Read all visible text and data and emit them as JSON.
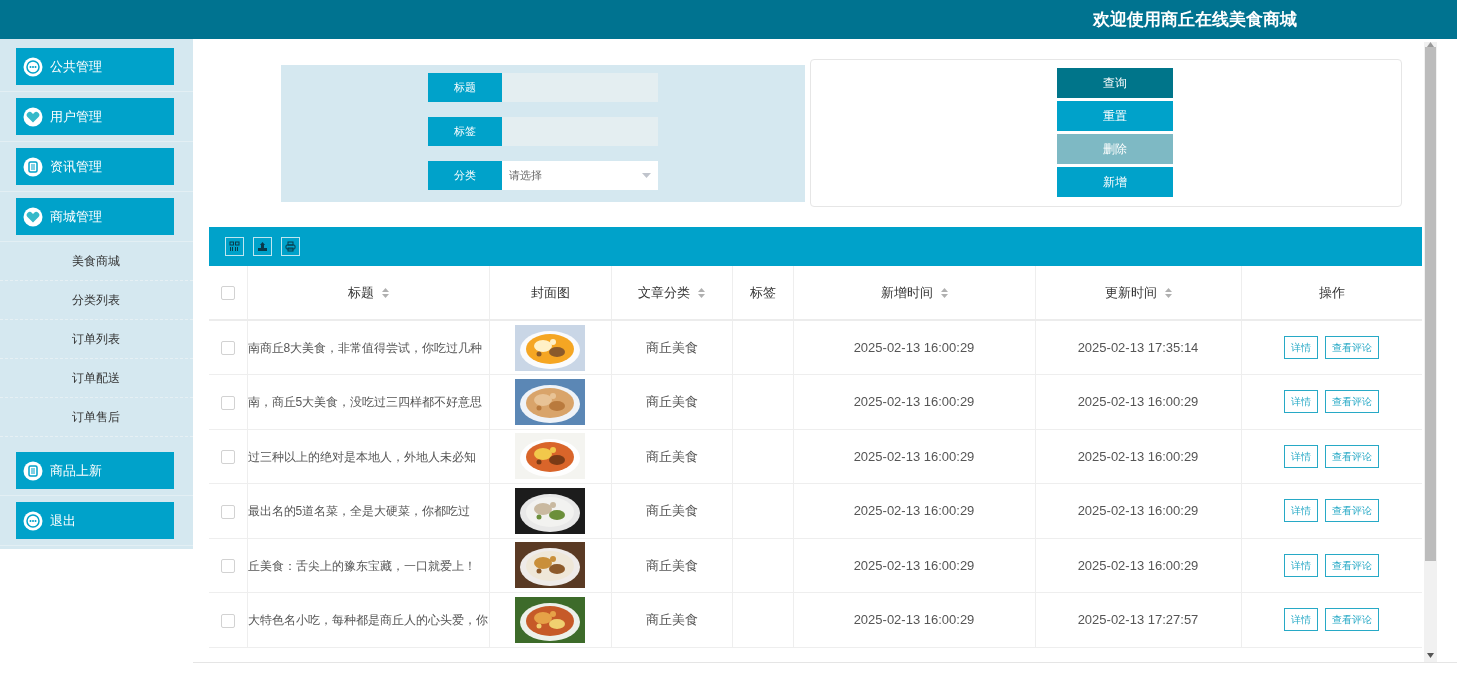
{
  "header": {
    "title": "欢迎使用商丘在线美食商城"
  },
  "sidebar": {
    "items": [
      {
        "label": "公共管理"
      },
      {
        "label": "用户管理"
      },
      {
        "label": "资讯管理"
      },
      {
        "label": "商城管理",
        "children": [
          {
            "label": "美食商城"
          },
          {
            "label": "分类列表"
          },
          {
            "label": "订单列表"
          },
          {
            "label": "订单配送"
          },
          {
            "label": "订单售后"
          }
        ]
      },
      {
        "label": "商品上新"
      },
      {
        "label": "退出"
      }
    ]
  },
  "search": {
    "fields": [
      {
        "label": "标题",
        "kind": "text"
      },
      {
        "label": "标签",
        "kind": "text"
      },
      {
        "label": "分类",
        "kind": "select",
        "placeholder": "请选择"
      }
    ]
  },
  "actions": [
    {
      "label": "查询",
      "kind": "primary",
      "disabled": false
    },
    {
      "label": "重置",
      "kind": "normal",
      "disabled": false
    },
    {
      "label": "删除",
      "kind": "primary",
      "disabled": true
    },
    {
      "label": "新增",
      "kind": "normal",
      "disabled": false
    }
  ],
  "table": {
    "all_selected": false,
    "columns": [
      {
        "label": "标题",
        "sortable": true
      },
      {
        "label": "封面图",
        "sortable": false
      },
      {
        "label": "文章分类",
        "sortable": true
      },
      {
        "label": "标签",
        "sortable": false
      },
      {
        "label": "新增时间",
        "sortable": true
      },
      {
        "label": "更新时间",
        "sortable": true
      },
      {
        "label": "操作",
        "sortable": false
      }
    ],
    "rows": [
      {
        "selected": false,
        "title": "南商丘8大美食，非常值得尝试，你吃过几种",
        "category": "商丘美食",
        "created": "2025-02-13 16:00:29",
        "updated": "2025-02-13 17:35:14",
        "actions": [
          "详情",
          "查看评论"
        ]
      },
      {
        "selected": false,
        "title": "南，商丘5大美食，没吃过三四样都不好意思",
        "category": "商丘美食",
        "created": "2025-02-13 16:00:29",
        "updated": "2025-02-13 16:00:29",
        "actions": [
          "详情",
          "查看评论"
        ]
      },
      {
        "selected": false,
        "title": "过三种以上的绝对是本地人，外地人未必知",
        "category": "商丘美食",
        "created": "2025-02-13 16:00:29",
        "updated": "2025-02-13 16:00:29",
        "actions": [
          "详情",
          "查看评论"
        ]
      },
      {
        "selected": false,
        "title": "最出名的5道名菜，全是大硬菜，你都吃过",
        "category": "商丘美食",
        "created": "2025-02-13 16:00:29",
        "updated": "2025-02-13 16:00:29",
        "actions": [
          "详情",
          "查看评论"
        ]
      },
      {
        "selected": false,
        "title": "丘美食：舌尖上的豫东宝藏，一口就爱上！",
        "category": "商丘美食",
        "created": "2025-02-13 16:00:29",
        "updated": "2025-02-13 16:00:29",
        "actions": [
          "详情",
          "查看评论"
        ]
      },
      {
        "selected": false,
        "title": "大特色名小吃，每种都是商丘人的心头爱，你",
        "category": "商丘美食",
        "created": "2025-02-13 16:00:29",
        "updated": "2025-02-13 17:27:57",
        "actions": [
          "详情",
          "查看评论"
        ]
      }
    ]
  }
}
